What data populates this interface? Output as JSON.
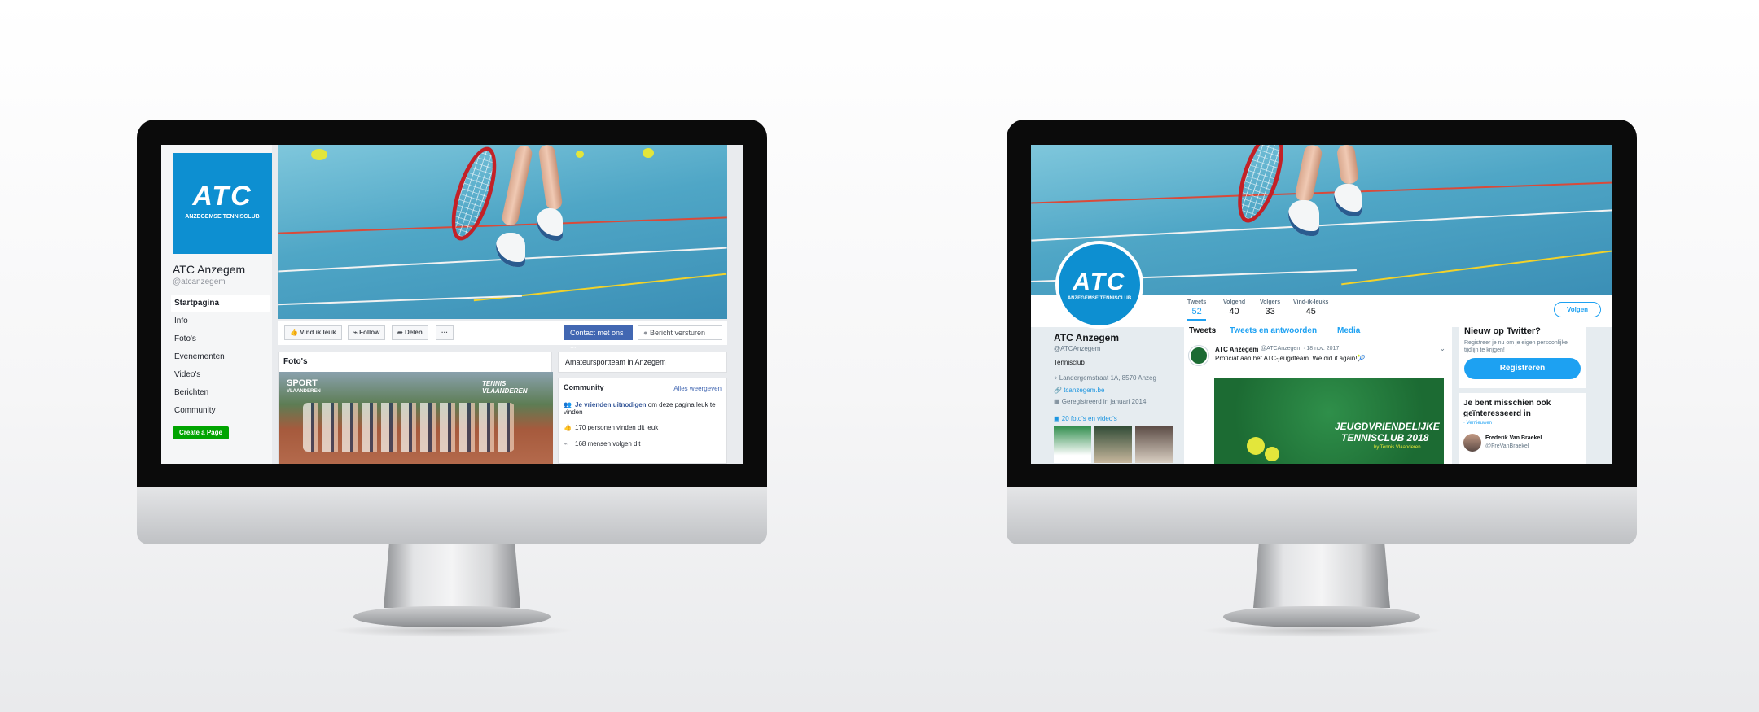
{
  "facebook": {
    "logo_text": "ATC",
    "logo_subtitle": "ANZEGEMSE TENNISCLUB",
    "page_name": "ATC Anzegem",
    "handle": "@atcanzegem",
    "nav": [
      "Startpagina",
      "Info",
      "Foto's",
      "Evenementen",
      "Video's",
      "Berichten",
      "Community"
    ],
    "create_page": "Create a Page",
    "actions": {
      "like": "Vind ik leuk",
      "follow": "Follow",
      "share": "Delen",
      "more": "···"
    },
    "contact": "Contact met ons ...",
    "message": "Bericht versturen",
    "photos_title": "Foto's",
    "photo_overlay_left": "SPORT",
    "photo_overlay_left_sub": "VLAANDEREN",
    "photo_overlay_right": "TENNIS VLAANDEREN",
    "category": "Amateursportteam in Anzegem",
    "community_title": "Community",
    "community_all": "Alles weergeven",
    "invite_link": "Je vrienden uitnodigen",
    "invite_rest": " om deze pagina leuk te vinden",
    "likes": "170 personen vinden dit leuk",
    "follows": "168 mensen volgen dit"
  },
  "twitter": {
    "logo_text": "ATC",
    "logo_subtitle": "ANZEGEMSE TENNISCLUB",
    "stats": [
      {
        "label": "Tweets",
        "value": "52"
      },
      {
        "label": "Volgend",
        "value": "40"
      },
      {
        "label": "Volgers",
        "value": "33"
      },
      {
        "label": "Vind-ik-leuks",
        "value": "45"
      }
    ],
    "follow": "Volgen",
    "name": "ATC Anzegem",
    "handle": "@ATCAnzegem",
    "bio": "Tennisclub",
    "location": "Landergemstraat 1A, 8570 Anzeg",
    "website": "tcanzegem.be",
    "joined": "Geregistreerd in januari 2014",
    "media_link": "20 foto's en video's",
    "tabs": [
      "Tweets",
      "Tweets en antwoorden",
      "Media"
    ],
    "tweet": {
      "author": "ATC Anzegem",
      "meta": "@ATCAnzegem · 18 nov. 2017",
      "text": "Proficiat aan het ATC-jeugdteam. We did it again!🎾"
    },
    "promo_line1": "JEUGDVRIENDELIJKE",
    "promo_line2": "TENNISCLUB 2018",
    "promo_line3": "by Tennis Vlaanderen",
    "new_title": "Nieuw op Twitter?",
    "new_text": "Registreer je nu om je eigen persoonlijke tijdlijn te krijgen!",
    "register": "Registreren",
    "suggest_title": "Je bent misschien ook geïnteresseerd in",
    "refresh": "· Vernieuwen",
    "suggest_name": "Frederik Van Braekel",
    "suggest_handle": "@FreVanBraekel"
  },
  "colors": {
    "facebook_blue": "#4267b2",
    "twitter_blue": "#1da1f2",
    "atc_blue": "#0d8fd1",
    "create_green": "#00a400"
  }
}
